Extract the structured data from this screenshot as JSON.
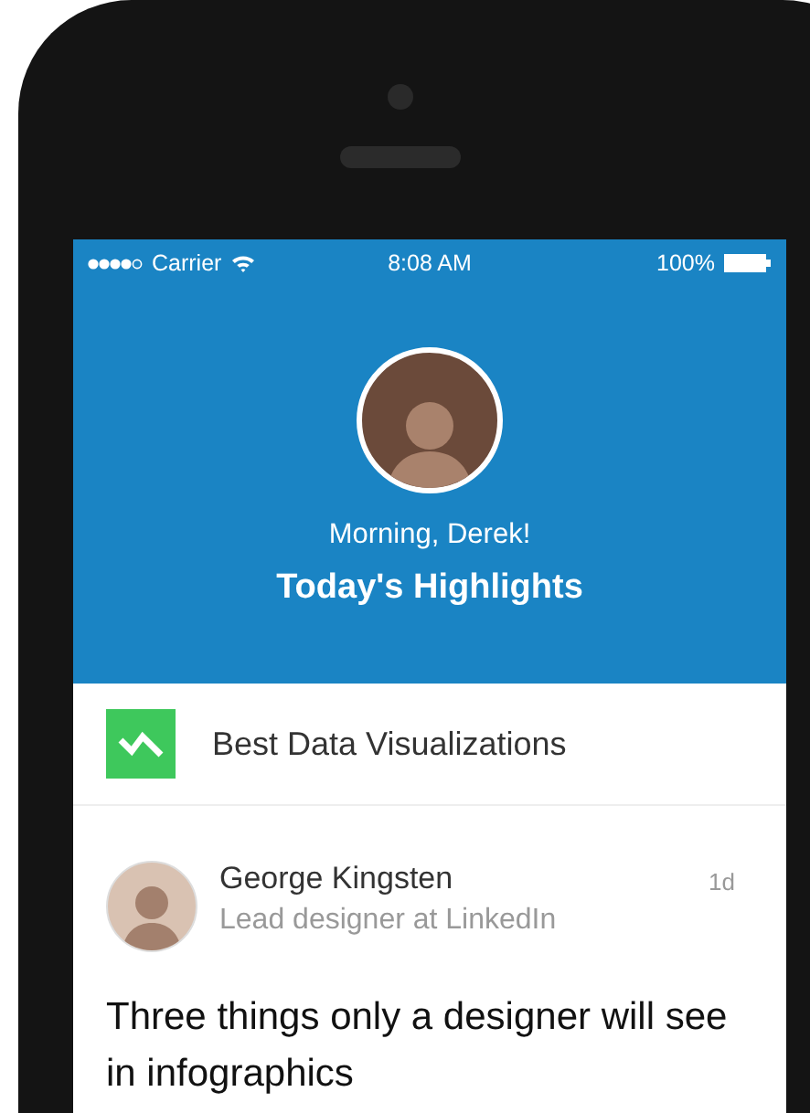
{
  "status_bar": {
    "carrier": "Carrier",
    "time": "8:08 AM",
    "battery": "100%"
  },
  "header": {
    "greeting": "Morning, Derek!",
    "title": "Today's Highlights"
  },
  "topic": {
    "label": "Best Data Visualizations"
  },
  "post": {
    "author": "George Kingsten",
    "role": "Lead designer at LinkedIn",
    "time": "1d",
    "headline": "Three things only a designer will see in infographics"
  }
}
